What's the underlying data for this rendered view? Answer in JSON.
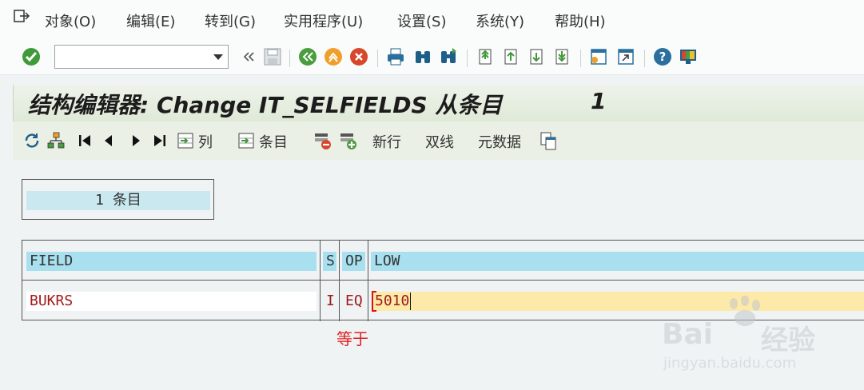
{
  "menu": {
    "items": [
      {
        "label": "对象(O)"
      },
      {
        "label": "编辑(E)"
      },
      {
        "label": "转到(G)"
      },
      {
        "label": "实用程序(U)"
      },
      {
        "label": "设置(S)"
      },
      {
        "label": "系统(Y)"
      },
      {
        "label": "帮助(H)"
      }
    ]
  },
  "command_field": {
    "value": ""
  },
  "title": {
    "text": "结构编辑器: Change IT_SELFIELDS 从条目",
    "number": "1"
  },
  "app_toolbar": {
    "column_label": "列",
    "entry_label": "条目",
    "new_row_label": "新行",
    "double_line_label": "双线",
    "metadata_label": "元数据"
  },
  "entries": {
    "text": "1 条目"
  },
  "table": {
    "headers": [
      "FIELD",
      "S",
      "OP",
      "LOW"
    ],
    "row": {
      "field": "BUKRS",
      "sign": "I",
      "op": "EQ",
      "low": "5010"
    }
  },
  "annotation": "等于",
  "watermark": {
    "brand": "Bai",
    "brand2": "经验",
    "url": "jingyan.baidu.com"
  },
  "colors": {
    "title_band": "#dfe9d8",
    "header_cell": "#a8e0ef",
    "input_bg": "#fde9a8",
    "data_text": "#a01a1a",
    "annotation": "#e02020"
  }
}
